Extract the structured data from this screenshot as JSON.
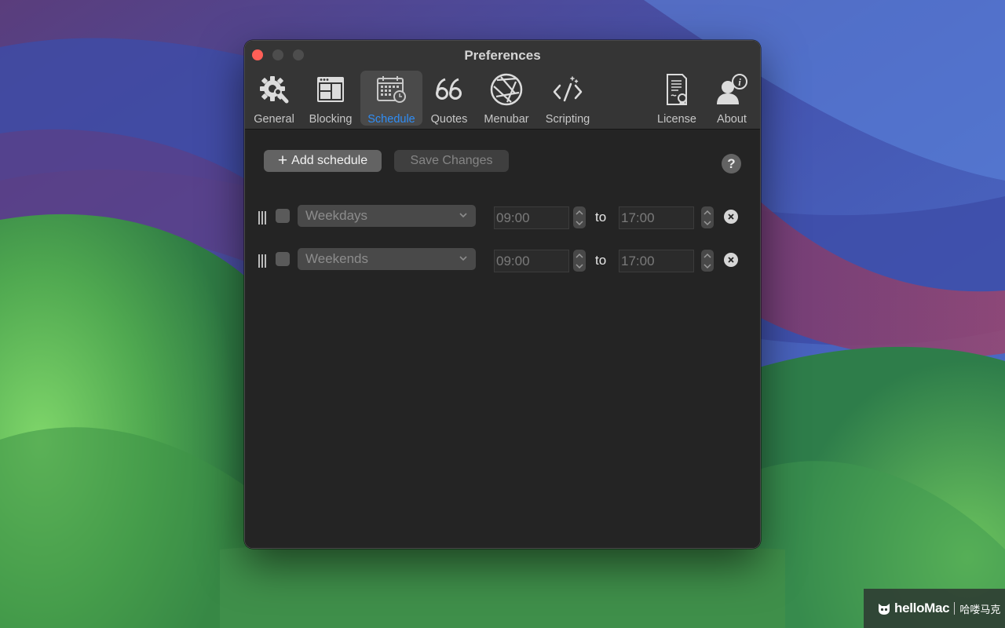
{
  "window": {
    "title": "Preferences"
  },
  "toolbar": {
    "tabs": [
      {
        "label": "General",
        "icon": "gear-icon",
        "selected": false
      },
      {
        "label": "Blocking",
        "icon": "browser-window-icon",
        "selected": false
      },
      {
        "label": "Schedule",
        "icon": "calendar-clock-icon",
        "selected": true
      },
      {
        "label": "Quotes",
        "icon": "quote-icon",
        "selected": false
      },
      {
        "label": "Menubar",
        "icon": "aperture-icon",
        "selected": false
      },
      {
        "label": "Scripting",
        "icon": "code-icon",
        "selected": false
      },
      {
        "label": "License",
        "icon": "certificate-icon",
        "selected": false
      },
      {
        "label": "About",
        "icon": "user-info-icon",
        "selected": false
      }
    ]
  },
  "actions": {
    "add_label": "Add schedule",
    "save_label": "Save Changes",
    "save_enabled": false,
    "help_label": "?"
  },
  "schedules": [
    {
      "days": "Weekdays",
      "enabled": false,
      "from": "09:00",
      "separator": "to",
      "to": "17:00"
    },
    {
      "days": "Weekends",
      "enabled": false,
      "from": "09:00",
      "separator": "to",
      "to": "17:00"
    }
  ],
  "watermark": {
    "brand": "helloMac",
    "chinese": "哈喽马克"
  },
  "colors": {
    "accent": "#2f8df5",
    "close": "#ff5f57",
    "window_bg": "#242424",
    "toolbar_bg": "#353535"
  }
}
